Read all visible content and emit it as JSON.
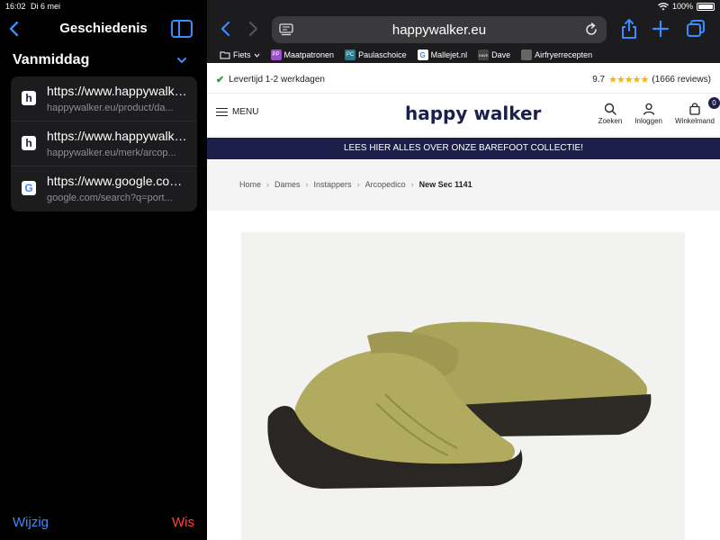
{
  "status": {
    "time": "16:02",
    "date": "Di 6 mei",
    "battery": "100%"
  },
  "sidebar": {
    "title": "Geschiedenis",
    "section": "Vanmiddag",
    "items": [
      {
        "title": "https://www.happywalker.eu/product/da...",
        "url": "happywalker.eu/product/da...",
        "icon": "h"
      },
      {
        "title": "https://www.happywalker.eu/merk/arcop...",
        "url": "happywalker.eu/merk/arcop...",
        "icon": "h"
      },
      {
        "title": "https://www.google.com/search?q=port...",
        "url": "google.com/search?q=port...",
        "icon": "G"
      }
    ],
    "edit_label": "Wijzig",
    "clear_label": "Wis"
  },
  "browser": {
    "url": "happywalker.eu",
    "bookmarks": [
      {
        "label": "Fiets",
        "icon": "folder-icon",
        "color": "#555555"
      },
      {
        "label": "Maatpatronen",
        "icon": "PP",
        "color": "#9b4dca"
      },
      {
        "label": "Paulaschoice",
        "icon": "PC",
        "color": "#2a7a8a"
      },
      {
        "label": "Mallejet.nl",
        "icon": "G",
        "color": "#ffffff"
      },
      {
        "label": "Dave",
        "icon": "DAVE",
        "color": "#444444"
      },
      {
        "label": "Airfryerrecepten",
        "icon": "doc",
        "color": "#666666"
      }
    ]
  },
  "page": {
    "delivery": "Levertijd 1-2 werkdagen",
    "rating_score": "9.7",
    "rating_stars": "★★★★★",
    "rating_reviews": "(1666 reviews)",
    "menu_label": "MENU",
    "logo": "happy walker",
    "search_label": "Zoeken",
    "login_label": "Inloggen",
    "cart_label": "Winkelmand",
    "cart_count": "0",
    "banner": "LEES HIER ALLES OVER ONZE BAREFOOT COLLECTIE!",
    "breadcrumb": [
      "Home",
      "Dames",
      "Instappers",
      "Arcopedico",
      "New Sec 1141"
    ]
  },
  "colors": {
    "accent": "#3b8cff",
    "brand": "#1b1f4a",
    "destructive": "#ff453a",
    "star": "#f4b400"
  }
}
